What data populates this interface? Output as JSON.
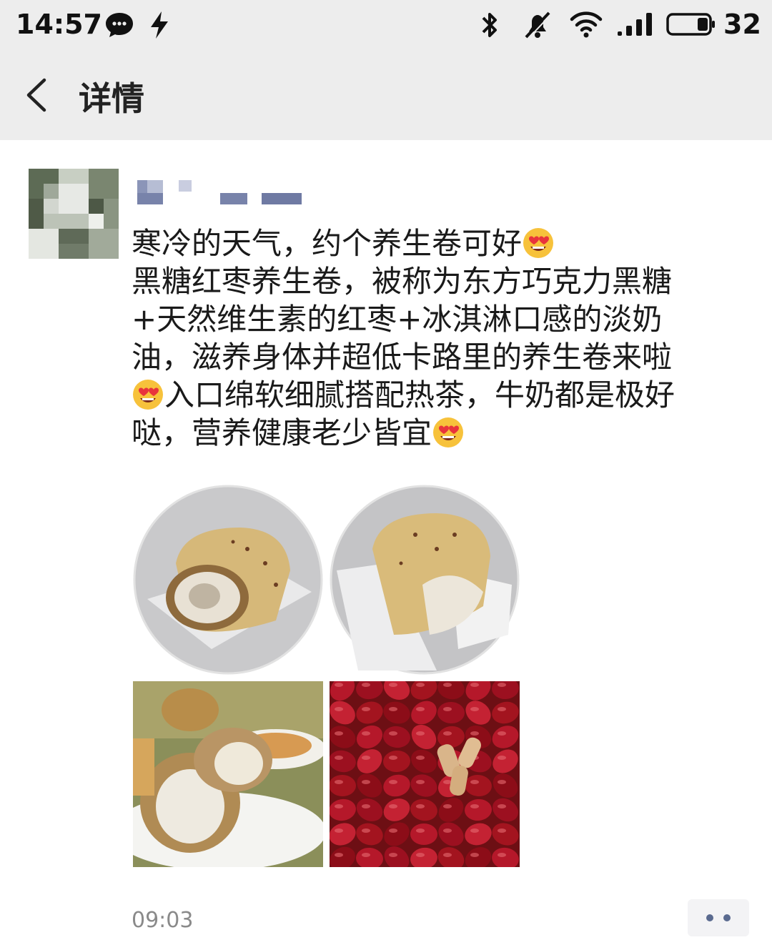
{
  "status_bar": {
    "time": "14:57",
    "battery_level": "32",
    "icons": [
      "chat-bubble-icon",
      "flash-icon",
      "bluetooth-icon",
      "mute-icon",
      "wifi-icon",
      "signal-icon",
      "battery-icon"
    ]
  },
  "nav": {
    "title": "详情",
    "back_icon": "chevron-left-icon"
  },
  "post": {
    "avatar": "blurred-avatar",
    "username": "",
    "text_lines": [
      "寒冷的天气，约个养生卷可好",
      "黑糖红枣养生卷，被称为东方巧克力黑糖",
      "+天然维生素的红枣+冰淇淋口感的淡奶",
      "油，滋养身体并超低卡路里的养生卷来啦",
      "入口绵软细腻搭配热茶，牛奶都是极好",
      "哒，营养健康老少皆宜"
    ],
    "emoji": "heart-eyes-emoji",
    "photos": [
      "cake-roll-photo",
      "cake-roll-photo",
      "cake-roll-tea-photo",
      "red-dates-photo"
    ],
    "time": "09:03",
    "more_icon": "more-dots-icon"
  },
  "colors": {
    "bar_background": "#ededed",
    "link_blue": "#5a6a8f",
    "time_gray": "#8a8a8a"
  }
}
